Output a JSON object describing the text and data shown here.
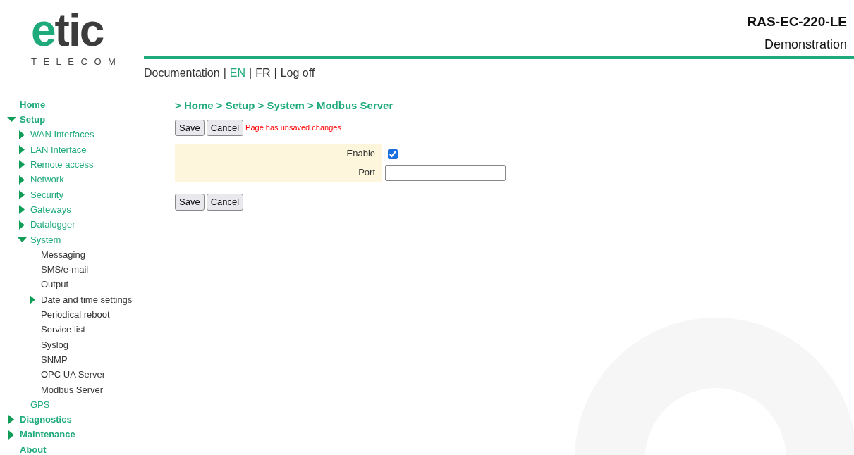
{
  "logo": {
    "word": "etic",
    "subtitle": "TELECOM"
  },
  "device": {
    "model": "RAS-EC-220-LE",
    "name": "Demonstration"
  },
  "header_links": {
    "separator": "|",
    "items": [
      {
        "label": "Documentation",
        "selected": false
      },
      {
        "label": "EN",
        "selected": true
      },
      {
        "label": "FR",
        "selected": false
      },
      {
        "label": "Log off",
        "selected": false
      }
    ]
  },
  "sidebar": {
    "items": [
      {
        "label": "Home",
        "kind": "leaf"
      },
      {
        "label": "Setup",
        "kind": "branch",
        "expanded": true,
        "children": [
          {
            "label": "WAN Interfaces",
            "kind": "branch",
            "expanded": false
          },
          {
            "label": "LAN Interface",
            "kind": "branch",
            "expanded": false
          },
          {
            "label": "Remote access",
            "kind": "branch",
            "expanded": false
          },
          {
            "label": "Network",
            "kind": "branch",
            "expanded": false
          },
          {
            "label": "Security",
            "kind": "branch",
            "expanded": false
          },
          {
            "label": "Gateways",
            "kind": "branch",
            "expanded": false
          },
          {
            "label": "Datalogger",
            "kind": "branch",
            "expanded": false
          },
          {
            "label": "System",
            "kind": "branch",
            "expanded": true,
            "children": [
              {
                "label": "Messaging",
                "kind": "leaf"
              },
              {
                "label": "SMS/e-mail",
                "kind": "leaf"
              },
              {
                "label": "Output",
                "kind": "leaf"
              },
              {
                "label": "Date and time settings",
                "kind": "branch",
                "expanded": false
              },
              {
                "label": "Periodical reboot",
                "kind": "leaf"
              },
              {
                "label": "Service list",
                "kind": "leaf"
              },
              {
                "label": "Syslog",
                "kind": "leaf"
              },
              {
                "label": "SNMP",
                "kind": "leaf"
              },
              {
                "label": "OPC UA Server",
                "kind": "leaf"
              },
              {
                "label": "Modbus Server",
                "kind": "leaf"
              }
            ]
          },
          {
            "label": "GPS",
            "kind": "leaf"
          }
        ]
      },
      {
        "label": "Diagnostics",
        "kind": "branch",
        "expanded": false
      },
      {
        "label": "Maintenance",
        "kind": "branch",
        "expanded": false
      },
      {
        "label": "About",
        "kind": "leaf"
      }
    ]
  },
  "breadcrumb": "> Home > Setup > System > Modbus Server",
  "top_buttons": [
    "Save",
    "Cancel"
  ],
  "unsaved_message": "Page has unsaved changes",
  "form": {
    "rows": [
      {
        "label": "Enable",
        "kind": "checkbox",
        "checked": true
      },
      {
        "label": "Port",
        "kind": "text",
        "value": ""
      }
    ]
  },
  "bottom_buttons": [
    "Save",
    "Cancel"
  ]
}
